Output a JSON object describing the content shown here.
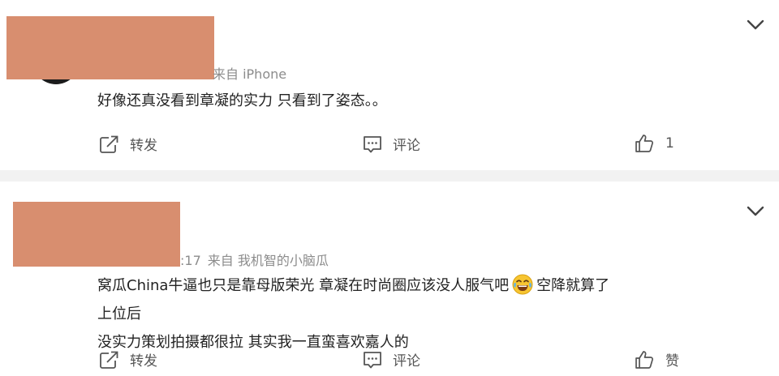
{
  "posts": [
    {
      "source_text": "来自 iPhone",
      "text": "好像还真没看到章凝的实力 只看到了姿态。。",
      "actions": {
        "repost": "转发",
        "comment": "评论",
        "like": "1"
      }
    },
    {
      "time_fragment": ":17",
      "source_text": "来自 我机智的小脑瓜",
      "text_part1": "窝瓜China牛逼也只是靠母版荣光 章凝在时尚圈应该没人服气吧",
      "text_part2": "空降就算了 上位后",
      "text_line2": "没实力策划拍摄都很拉 其实我一直蛮喜欢嘉人的",
      "emoji_icon": "laughing-tears-icon",
      "actions": {
        "repost": "转发",
        "comment": "评论",
        "like": "赞"
      }
    }
  ],
  "colors": {
    "redaction": "#d88e6f",
    "divider": "#f2f2f2",
    "meta_text": "#8c8c8c"
  }
}
